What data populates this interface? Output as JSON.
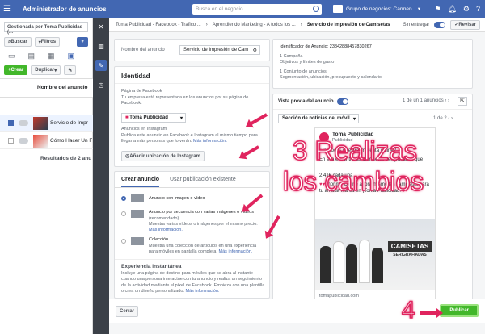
{
  "topbar": {
    "title": "Administrador de anuncios",
    "search_placeholder": "Busca en el negocio",
    "business": "Grupo de negocios: Carmen ..."
  },
  "leftbar": {
    "account": "Gestionada por Toma Publicidad (...",
    "buscar": "Buscar",
    "filtros": "Filtros",
    "crear": "Crear",
    "duplicar": "Duplicar",
    "col_header": "Nombre del anuncio",
    "rows": [
      "Servicio de Impr",
      "Cómo Hacer Un F"
    ],
    "results": "Resultados de 2 anu"
  },
  "breadcrumb": {
    "items": [
      "Toma Publicidad - Facebook - Trafico ...",
      "Aprendiendo Marketing - A todos los ...",
      "Servicio de Impresión de Camisetas"
    ],
    "status": "Sin entregar",
    "revisar": "Revisar"
  },
  "ad_name": {
    "label": "Nombre del anuncio",
    "value": "Servicio de Impresión de Cam"
  },
  "ad_info": {
    "id_label": "Identificador de Anuncio: 23842888457830267",
    "campaign_link": "1 Campaña",
    "campaign_desc": "Objetivos y límites de gasto",
    "adset_link": "1 Conjunto de anuncios",
    "adset_desc": "Segmentación, ubicación, presupuesto y calendario"
  },
  "identity": {
    "title": "Identidad",
    "fb_page_label": "Página de Facebook",
    "fb_page_desc": "Tu empresa está representada en los anuncios por su página de Facebook.",
    "fb_page_value": "Toma Publicidad",
    "ig_label": "Anuncios en Instagram",
    "ig_desc": "Publica este anuncio en Facebook e Instagram al mismo tiempo para llegar a más personas que lo verán.",
    "ig_more": "Más información.",
    "ig_button": "Añadir ubicación de Instagram"
  },
  "create": {
    "tab_create": "Crear anuncio",
    "tab_existing": "Usar publicación existente",
    "opt1": "Anuncio con imagen o vídeo",
    "opt2": "Anuncio por secuencia con varias imágenes o vídeos",
    "opt2_rec": "(recomendado)",
    "opt2_desc": "Muestra varias vídeos o imágenes por el mismo precio.",
    "opt2_more": "Más información.",
    "opt3": "Colección",
    "opt3_desc": "Muestra una colección de artículos en una experiencia para móviles en pantalla completa.",
    "opt3_more": "Más información.",
    "instant_title": "Experiencia instantánea",
    "instant_desc": "Incluye una página de destino para móviles que se abra al instante cuando una persona interactúe con tu anuncio y realiza un seguimiento de la actividad mediante el píxel de Facebook. Empieza con una plantilla o crea un diseño personalizado.",
    "instant_more": "Más información."
  },
  "preview": {
    "label": "Vista previa del anuncio",
    "pager": "1 de un 1 anuncios",
    "placement": "Sección de noticias del móvil",
    "pager2": "1 de 2",
    "page_name": "Toma Publicidad",
    "sponsored": "Publicidad",
    "text1": "¿Conoces nuestra imprenta online?",
    "text2": "En ella encontrarás camisetas serigrafiadas que",
    "text3": "2,41€ cada una",
    "text4": "Imprime Online ahora mismo las camisetas para tu amada marca en ¡Toma Publicidad!",
    "image_title": "CAMISETAS",
    "image_sub": "SERIGRAFIADAS",
    "url": "tomapublicidad.com"
  },
  "bottom": {
    "cancel": "Cerrar",
    "publish": "Publicar"
  },
  "annotations": {
    "step3a": "3 Realizas",
    "step3b": "los cambios",
    "step4": "4"
  }
}
